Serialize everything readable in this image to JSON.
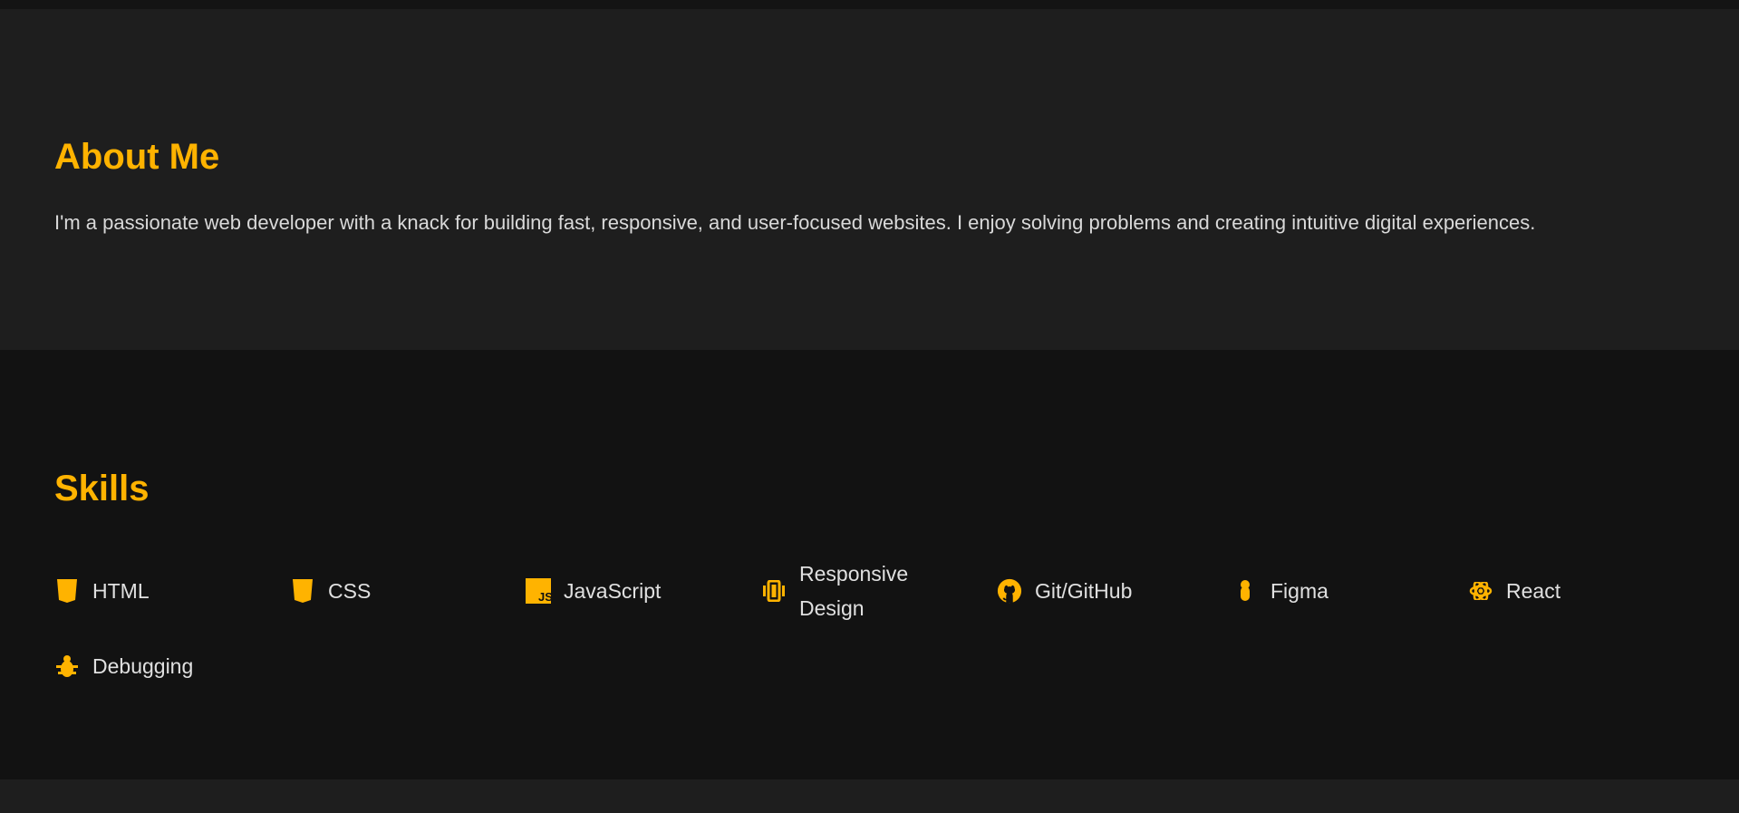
{
  "about": {
    "heading": "About Me",
    "text": "I'm a passionate web developer with a knack for building fast, responsive, and user-focused websites. I enjoy solving problems and creating intuitive digital experiences."
  },
  "skills": {
    "heading": "Skills",
    "items": [
      {
        "label": "HTML",
        "icon": "html5-icon"
      },
      {
        "label": "CSS",
        "icon": "css3-icon"
      },
      {
        "label": "JavaScript",
        "icon": "javascript-icon"
      },
      {
        "label": "Responsive Design",
        "icon": "responsive-device-icon"
      },
      {
        "label": "Git/GitHub",
        "icon": "github-icon"
      },
      {
        "label": "Figma",
        "icon": "figma-icon"
      },
      {
        "label": "React",
        "icon": "react-icon"
      },
      {
        "label": "Debugging",
        "icon": "bug-icon"
      }
    ]
  },
  "colors": {
    "accent": "#ffb300",
    "section_light": "#1e1e1e",
    "section_dark": "#121212",
    "text": "#e0e0e0"
  }
}
